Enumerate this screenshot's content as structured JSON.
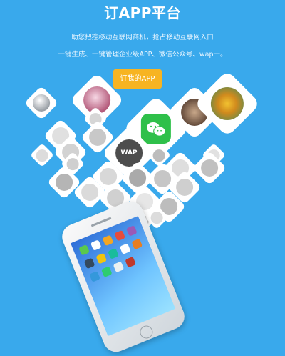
{
  "header": {
    "title": "订APP平台",
    "line1": "助您把控移动互联网商机，抢占移动互联网入口",
    "line2": "一键生成、一键管理企业级APP、微信公众号、wap一。"
  },
  "cta": {
    "label": "订我的APP"
  },
  "wap_icon": {
    "label": "WAP"
  },
  "colors": {
    "background": "#39a9ec",
    "cta": "#f7b422",
    "wechat": "#2fc04a"
  }
}
